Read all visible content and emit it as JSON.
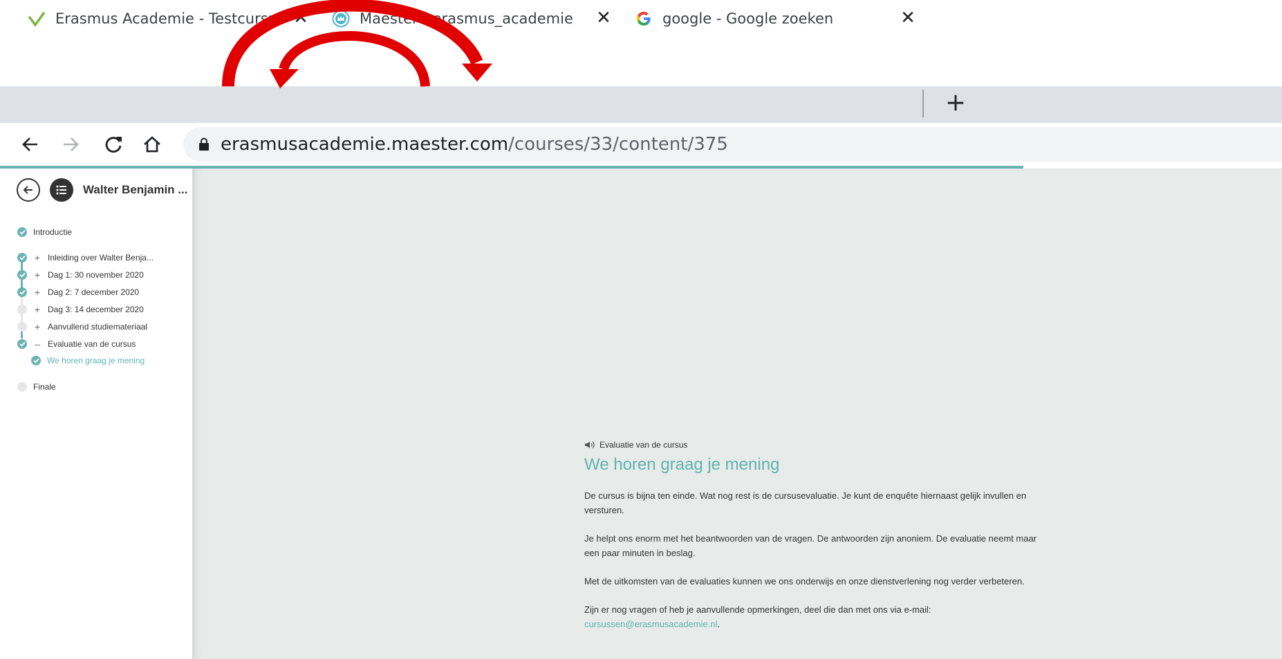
{
  "tabs": [
    {
      "title": "Erasmus Academie - Testcursus",
      "favicon": "erasmus-checkmark-icon"
    },
    {
      "title": "Maester - erasmus_academie",
      "favicon": "maester-crown-icon",
      "active": true
    },
    {
      "title": "google - Google zoeken",
      "favicon": "google-g-icon"
    }
  ],
  "toolbar": {
    "url_host": "erasmusacademie.maester.com",
    "url_path": "/courses/33/content/375"
  },
  "sidebar": {
    "course_title": "Walter Benjamin ...",
    "items": [
      {
        "label": "Introductie",
        "status": "done"
      },
      {
        "label": "Inleiding over Walter Benja...",
        "status": "done",
        "toggle": "+"
      },
      {
        "label": "Dag 1: 30 november 2020",
        "status": "done",
        "toggle": "+"
      },
      {
        "label": "Dag 2: 7 december 2020",
        "status": "done",
        "toggle": "+"
      },
      {
        "label": "Dag 3: 14 december 2020",
        "status": "todo",
        "toggle": "+"
      },
      {
        "label": "Aanvullend studiemateriaal",
        "status": "todo",
        "toggle": "+"
      },
      {
        "label": "Evaluatie van de cursus",
        "status": "done",
        "toggle": "–"
      },
      {
        "label": "We horen graag je mening",
        "status": "done",
        "current": true
      },
      {
        "label": "Finale",
        "status": "todo"
      }
    ]
  },
  "main": {
    "breadcrumb": "Evaluatie van de cursus",
    "title": "We horen graag je mening",
    "paragraphs": [
      "De cursus is bijna ten einde. Wat nog rest is de cursusevaluatie. Je kunt de enquête hiernaast gelijk invullen en versturen.",
      "Je helpt ons enorm met het beantwoorden van de vragen. De antwoorden zijn anoniem. De evaluatie neemt maar een paar minuten in beslag.",
      "Met de uitkomsten van de evaluaties kunnen we ons onderwijs en onze dienstverlening nog verder verbeteren.",
      "Zijn er nog vragen of heb je aanvullende opmerkingen, deel die dan met ons via e-mail:"
    ],
    "email": "cursussen@erasmusacademie.nl",
    "email_suffix": "."
  },
  "colors": {
    "accent": "#5fb3b0",
    "annotation_arrow": "#e00000",
    "content_bg": "#e7ecea",
    "tabstrip_bg": "#dee1e6"
  }
}
